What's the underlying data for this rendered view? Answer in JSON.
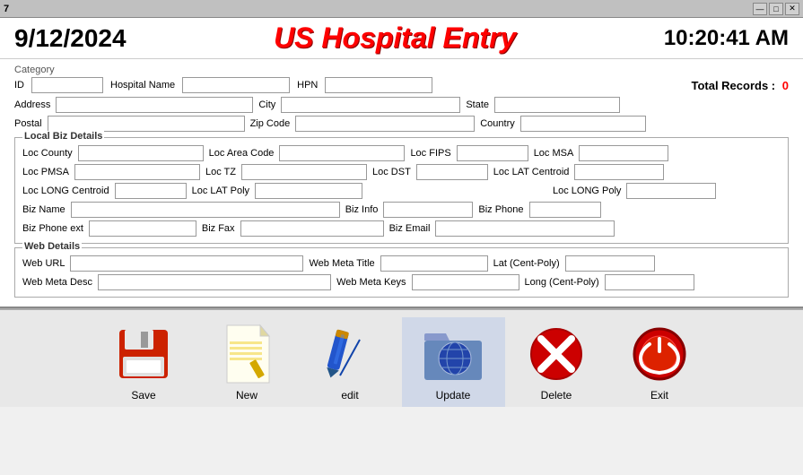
{
  "titlebar": {
    "title": "7",
    "minimize": "—",
    "maximize": "□",
    "close": "✕"
  },
  "header": {
    "date": "9/12/2024",
    "app_title": "US Hospital Entry",
    "time": "10:20:41 AM"
  },
  "form": {
    "category_label": "Category",
    "id_label": "ID",
    "hospital_name_label": "Hospital Name",
    "hpn_label": "HPN",
    "total_records_label": "Total Records :",
    "total_records_value": "0",
    "address_label": "Address",
    "city_label": "City",
    "state_label": "State",
    "postal_label": "Postal",
    "zip_code_label": "Zip Code",
    "country_label": "Country",
    "local_biz_label": "Local  Biz Details",
    "loc_county_label": "Loc County",
    "loc_area_code_label": "Loc Area Code",
    "loc_fips_label": "Loc FIPS",
    "loc_msa_label": "Loc MSA",
    "loc_pmsa_label": "Loc PMSA",
    "loc_tz_label": "Loc TZ",
    "loc_dst_label": "Loc DST",
    "loc_lat_centroid_label": "Loc LAT Centroid",
    "loc_long_centroid_label": "Loc LONG Centroid",
    "loc_lat_poly_label": "Loc LAT Poly",
    "loc_long_poly_label": "Loc LONG Poly",
    "biz_name_label": "Biz Name",
    "biz_info_label": "Biz Info",
    "biz_phone_label": "Biz Phone",
    "biz_phone_ext_label": "Biz Phone ext",
    "biz_fax_label": "Biz Fax",
    "biz_email_label": "Biz Email",
    "web_details_label": "Web Details",
    "web_url_label": "Web URL",
    "web_meta_title_label": "Web Meta Title",
    "lat_cent_poly_label": "Lat (Cent-Poly)",
    "web_meta_desc_label": "Web Meta Desc",
    "web_meta_keys_label": "Web Meta Keys",
    "long_cent_poly_label": "Long (Cent-Poly)"
  },
  "toolbar": {
    "save_label": "Save",
    "new_label": "New",
    "edit_label": "edit",
    "update_label": "Update",
    "delete_label": "Delete",
    "exit_label": "Exit"
  }
}
